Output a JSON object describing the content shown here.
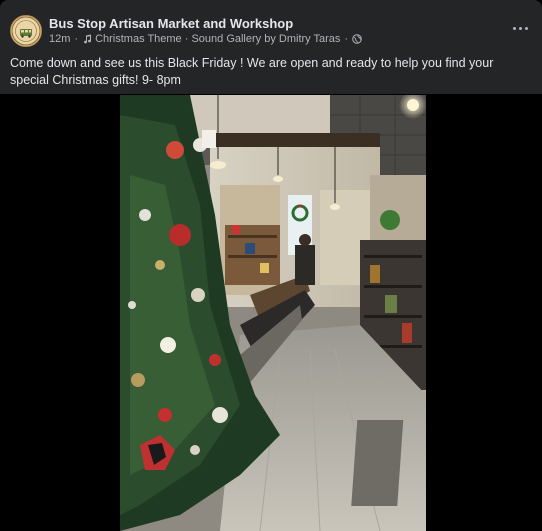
{
  "post": {
    "page_name": "Bus Stop Artisan Market and Workshop",
    "avatar_text": "BUS STOP",
    "time": "12m",
    "separator": "·",
    "audio": "Christmas Theme · Sound Gallery by Dmitry Taras",
    "audience_icon": "globe-icon",
    "music_icon": "music-note-icon",
    "more_icon": "more-options-icon",
    "text": "Come down and see us this Black Friday ! We are open and ready to help you find your special Christmas gifts! 9- 8pm"
  },
  "colors": {
    "background": "#000000",
    "card": "#242526",
    "primary_text": "#e4e6eb",
    "secondary_text": "#b0b3b8"
  }
}
